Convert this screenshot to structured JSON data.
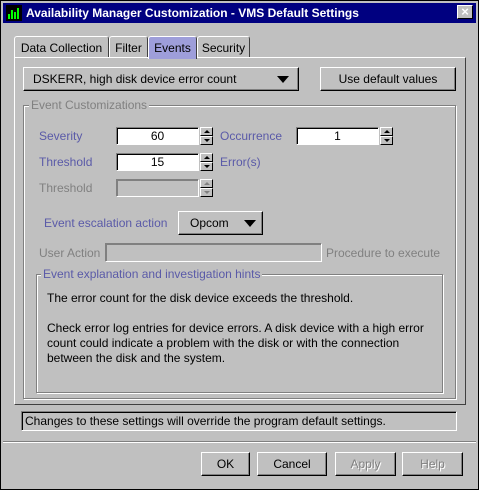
{
  "window": {
    "title": "Availability Manager Customization - VMS Default Settings",
    "close_glyph": "×"
  },
  "tabs": [
    {
      "label": "Data Collection",
      "active": false
    },
    {
      "label": "Filter",
      "active": false
    },
    {
      "label": "Events",
      "active": true
    },
    {
      "label": "Security",
      "active": false
    }
  ],
  "event_select": {
    "value": "DSKERR, high disk device error count"
  },
  "default_button": {
    "label": "Use default values"
  },
  "customizations": {
    "title": "Event Customizations",
    "severity_label": "Severity",
    "severity_value": "60",
    "occurrence_label": "Occurrence",
    "occurrence_value": "1",
    "threshold_label": "Threshold",
    "threshold_value": "15",
    "threshold_unit": "Error(s)",
    "threshold2_label": "Threshold",
    "threshold2_value": "",
    "escalation_label": "Event escalation action",
    "escalation_value": "Opcom",
    "user_action_label": "User Action",
    "user_action_value": "",
    "procedure_label": "Procedure to execute"
  },
  "hints": {
    "title": "Event explanation and investigation hints",
    "line1": "The error count for the disk device exceeds the threshold.",
    "line2": "Check error log entries for device errors.  A disk device with a high error",
    "line3": "count could indicate a problem with the disk or with the connection",
    "line4": "between the disk and the system."
  },
  "status": "Changes to these settings will override the program default settings.",
  "buttons": {
    "ok": "OK",
    "cancel": "Cancel",
    "apply": "Apply",
    "help": "Help"
  },
  "colors": {
    "titlebar": "#000080",
    "face": "#c0c0c0",
    "active_tab": "#9e9eda",
    "label": "#5a5aa8"
  }
}
